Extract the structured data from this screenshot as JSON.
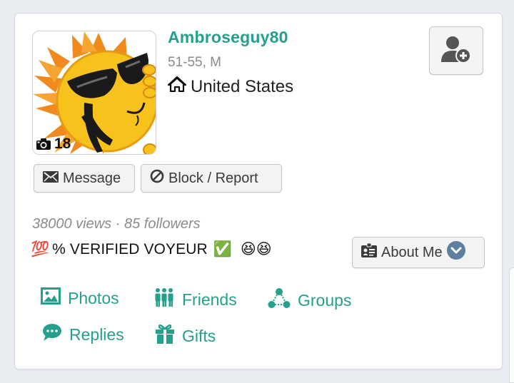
{
  "profile": {
    "username": "Ambroseguy80",
    "age_sex": "51-55, M",
    "location": "United States",
    "photo_count": "18"
  },
  "actions": {
    "message_label": "Message",
    "block_label": "Block / Report",
    "about_label": "About Me"
  },
  "stats": {
    "text": "38000 views · 85 followers"
  },
  "bio": {
    "prefix_emoji": "💯",
    "text": "% VERIFIED VOYEUR",
    "check_emoji": "✅",
    "laugh_emojis": "😆😆"
  },
  "nav": {
    "photos": "Photos",
    "friends": "Friends",
    "groups": "Groups",
    "replies": "Replies",
    "gifts": "Gifts"
  },
  "colors": {
    "accent": "#25a08c",
    "background": "#e9edf1"
  },
  "icons": [
    "camera-icon",
    "home-icon",
    "add-user-icon",
    "envelope-icon",
    "ban-icon",
    "id-card-icon",
    "chevron-down-icon",
    "image-icon",
    "users-icon",
    "groups-icon",
    "comment-icon",
    "gift-icon"
  ]
}
